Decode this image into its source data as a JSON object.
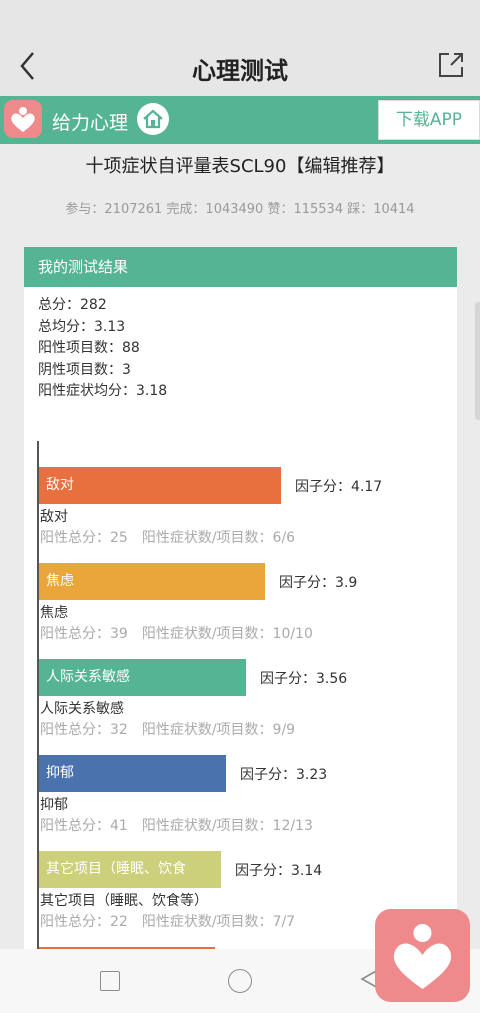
{
  "header": {
    "title": "心理测试"
  },
  "appbar": {
    "brand": "给力心理",
    "download_label": "下载APP"
  },
  "test": {
    "title": "十项症状自评量表SCL90【编辑推荐】",
    "stats": "参与：2107261 完成：1043490 赞：115534 踩：10414"
  },
  "result": {
    "heading": "我的测试结果",
    "summary": [
      "总分：282",
      "总均分：3.13",
      "阳性项目数：88",
      "阴性项目数：3",
      "阳性症状均分：3.18"
    ]
  },
  "chart_data": {
    "type": "bar",
    "orientation": "horizontal",
    "categories": [
      "敌对",
      "焦虑",
      "人际关系敏感",
      "抑郁",
      "其它项目（睡眠、饮食等）"
    ],
    "values": [
      4.17,
      3.9,
      3.56,
      3.23,
      3.14
    ],
    "bar_labels": [
      "敌对",
      "焦虑",
      "人际关系敏感",
      "抑郁",
      "其它项目（睡眠、饮食"
    ],
    "factor_labels": [
      "因子分：4.17",
      "因子分：3.9",
      "因子分：3.56",
      "因子分：3.23",
      "因子分：3.14"
    ],
    "detail_names": [
      "敌对",
      "焦虑",
      "人际关系敏感",
      "抑郁",
      "其它项目（睡眠、饮食等）"
    ],
    "detail_meta": [
      "阳性总分：25　阳性症状数/项目数：6/6",
      "阳性总分：39　阳性症状数/项目数：10/10",
      "阳性总分：32　阳性症状数/项目数：9/9",
      "阳性总分：41　阳性症状数/项目数：12/13",
      "阳性总分：22　阳性症状数/项目数：7/7"
    ],
    "colors": [
      "#e8703f",
      "#eaa63a",
      "#55b493",
      "#4a72ad",
      "#ccd07a"
    ],
    "partial_bar_color": "#e8703f"
  }
}
